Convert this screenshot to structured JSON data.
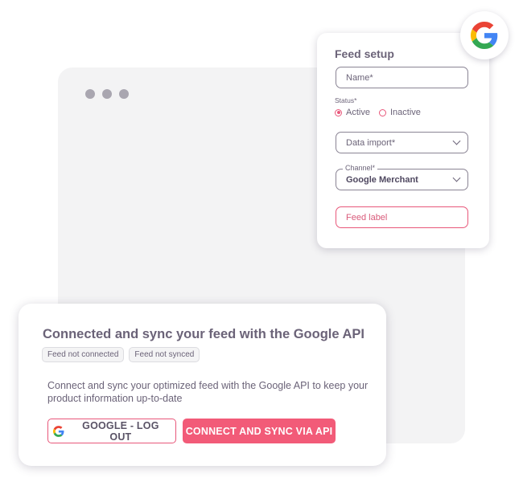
{
  "setup": {
    "title": "Feed setup",
    "name_placeholder": "Name*",
    "status_label": "Status*",
    "status_options": [
      {
        "label": "Active",
        "checked": true
      },
      {
        "label": "Inactive",
        "checked": false
      }
    ],
    "data_import_placeholder": "Data import*",
    "channel_label": "Channel*",
    "channel_value": "Google Merchant",
    "feed_label_placeholder": "Feed label"
  },
  "connect": {
    "title": "Connected and sync your feed with the Google API",
    "badges": [
      "Feed not connected",
      "Feed not synced"
    ],
    "description": "Connect and sync your optimized feed with the Google API to keep your product information up-to-date",
    "google_button_label": "GOOGLE - LOG OUT",
    "api_button_label": "CONNECT AND SYNC VIA API"
  },
  "colors": {
    "accent": "#f25b78",
    "text": "#6b6378",
    "window_bg": "#f3f3f4"
  },
  "icons": {
    "badge": "google-logo-icon",
    "google_button": "google-logo-icon",
    "dropdown": "chevron-down-icon"
  }
}
